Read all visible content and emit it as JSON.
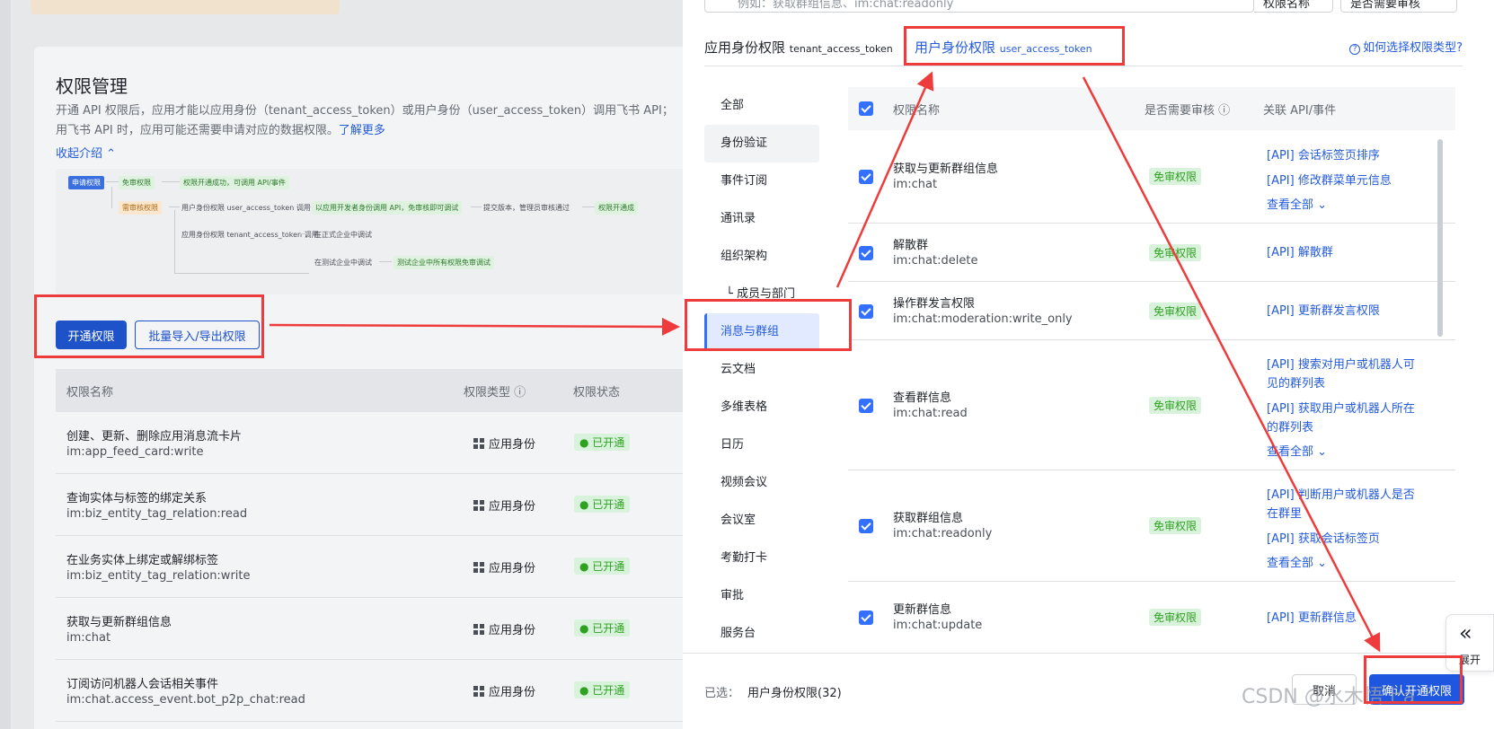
{
  "left_page": {
    "title": "权限管理",
    "desc_line1": "开通 API 权限后，应用才能以应用身份（tenant_access_token）或用户身份（user_access_token）调用飞书 API；",
    "desc_line2": "用飞书 API 时，应用可能还需要申请对应的数据权限。",
    "learn_more": "了解更多",
    "collapse": "收起介绍 ⌃",
    "flow": {
      "apply": "申请权限",
      "free": "免审权限",
      "free_result": "权限开通成功，可调用 API/事件",
      "review": "需审核权限",
      "user_identity": "用户身份权限 user_access_token 调用",
      "dev_identity_call": "以应用开发者身份调用 API，免审核即可调试",
      "submit": "提交版本，管理员审核通过",
      "enabled": "权限开通成",
      "app_identity": "应用身份权限 tenant_access_token 调用",
      "formal_debug": "在正式企业中调试",
      "test_debug": "在测试企业中调试",
      "test_result": "测试企业中所有权限免审调试"
    },
    "btn_enable": "开通权限",
    "btn_batch": "批量导入/导出权限",
    "table_headers": {
      "name": "权限名称",
      "type": "权限类型 ⓘ",
      "status": "权限状态"
    },
    "rows": [
      {
        "name": "创建、更新、删除应用消息流卡片",
        "code": "im:app_feed_card:write",
        "type": "应用身份",
        "status": "已开通"
      },
      {
        "name": "查询实体与标签的绑定关系",
        "code": "im:biz_entity_tag_relation:read",
        "type": "应用身份",
        "status": "已开通"
      },
      {
        "name": "在业务实体上绑定或解绑标签",
        "code": "im:biz_entity_tag_relation:write",
        "type": "应用身份",
        "status": "已开通"
      },
      {
        "name": "获取与更新群组信息",
        "code": "im:chat",
        "type": "应用身份",
        "status": "已开通"
      },
      {
        "name": "订阅访问机器人会话相关事件",
        "code": "im:chat.access_event.bot_p2p_chat:read",
        "type": "应用身份",
        "status": "已开通"
      }
    ]
  },
  "drawer": {
    "search_placeholder": "例如：获取群组信息、im:chat:readonly",
    "search_filter": "权限名称",
    "review_filter": "是否需要审核",
    "tab_app": "应用身份权限",
    "tab_app_token": "tenant_access_token",
    "tab_user": "用户身份权限",
    "tab_user_token": "user_access_token",
    "help_link": "如何选择权限类型?",
    "categories": [
      {
        "label": "全部",
        "style": ""
      },
      {
        "label": "身份验证",
        "style": "gray"
      },
      {
        "label": "事件订阅",
        "style": ""
      },
      {
        "label": "通讯录",
        "style": ""
      },
      {
        "label": "组织架构",
        "style": ""
      },
      {
        "label": "└ 成员与部门",
        "style": "sub"
      },
      {
        "label": "消息与群组",
        "style": "active"
      },
      {
        "label": "云文档",
        "style": ""
      },
      {
        "label": "多维表格",
        "style": ""
      },
      {
        "label": "日历",
        "style": ""
      },
      {
        "label": "视频会议",
        "style": ""
      },
      {
        "label": "会议室",
        "style": ""
      },
      {
        "label": "考勤打卡",
        "style": ""
      },
      {
        "label": "审批",
        "style": ""
      },
      {
        "label": "服务台",
        "style": ""
      }
    ],
    "table_headers": {
      "name": "权限名称",
      "review": "是否需要审核 ⓘ",
      "api": "关联 API/事件"
    },
    "rows": [
      {
        "name": "获取与更新群组信息",
        "code": "im:chat",
        "tag": "免审权限",
        "apis": [
          "[API] 会话标签页排序",
          "[API] 修改群菜单元信息"
        ],
        "view_all": "查看全部 ⌄"
      },
      {
        "name": "解散群",
        "code": "im:chat:delete",
        "tag": "免审权限",
        "apis": [
          "[API] 解散群"
        ],
        "view_all": ""
      },
      {
        "name": "操作群发言权限",
        "code": "im:chat:moderation:write_only",
        "tag": "免审权限",
        "apis": [
          "[API] 更新群发言权限"
        ],
        "view_all": ""
      },
      {
        "name": "查看群信息",
        "code": "im:chat:read",
        "tag": "免审权限",
        "apis": [
          "[API] 搜索对用户或机器人可见的群列表",
          "[API] 获取用户或机器人所在的群列表"
        ],
        "view_all": "查看全部 ⌄"
      },
      {
        "name": "获取群组信息",
        "code": "im:chat:readonly",
        "tag": "免审权限",
        "apis": [
          "[API] 判断用户或机器人是否在群里",
          "[API] 获取会话标签页"
        ],
        "view_all": "查看全部 ⌄"
      },
      {
        "name": "更新群信息",
        "code": "im:chat:update",
        "tag": "免审权限",
        "apis": [
          "[API] 更新群信息"
        ],
        "view_all": ""
      }
    ],
    "selected_label": "已选：",
    "selected_value": "用户身份权限(32)",
    "btn_cancel": "取消",
    "btn_confirm": "确认开通权限"
  },
  "expand": {
    "label": "展开"
  },
  "watermark": "CSDN @水木悟上a",
  "colors": {
    "accent": "#3370ff",
    "brand": "#245bdb",
    "annotation": "#ee3b3b",
    "tag_green": "#2ea121"
  }
}
